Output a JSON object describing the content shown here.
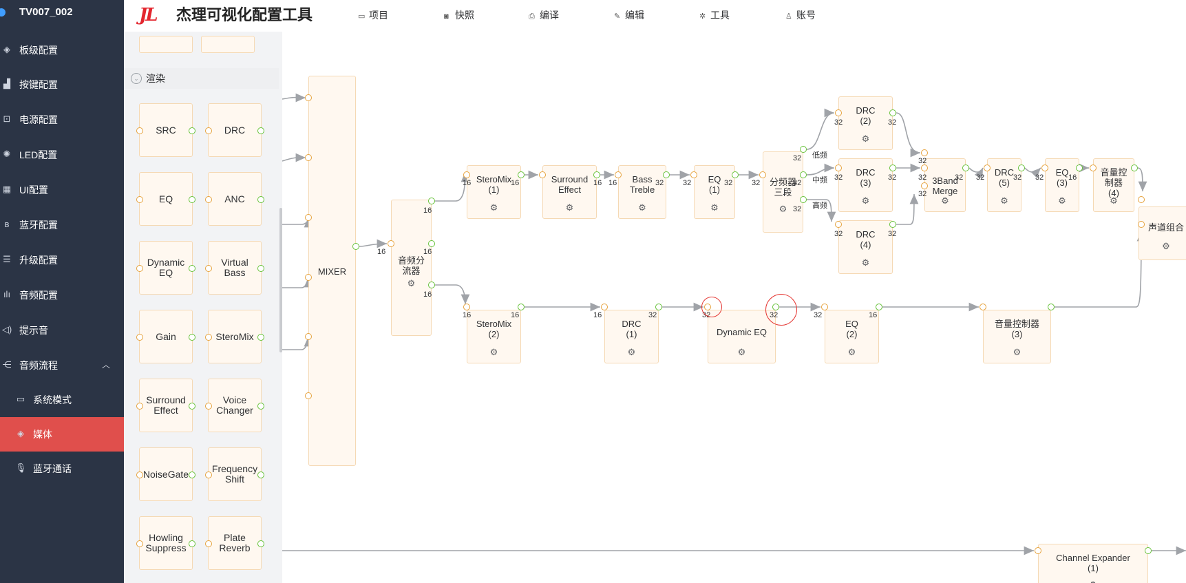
{
  "sidebar": {
    "title": "TV007_002",
    "items": [
      {
        "label": "板级配置",
        "icon": "cube-icon"
      },
      {
        "label": "按键配置",
        "icon": "keys-icon"
      },
      {
        "label": "电源配置",
        "icon": "power-icon"
      },
      {
        "label": "LED配置",
        "icon": "led-icon"
      },
      {
        "label": "UI配置",
        "icon": "ui-grid-icon"
      },
      {
        "label": "蓝牙配置",
        "icon": "bluetooth-icon"
      },
      {
        "label": "升级配置",
        "icon": "list-icon"
      },
      {
        "label": "音频配置",
        "icon": "audio-wave-icon"
      },
      {
        "label": "提示音",
        "icon": "speaker-icon"
      },
      {
        "label": "音频流程",
        "icon": "flow-icon"
      }
    ],
    "sub_items": [
      {
        "label": "系统模式",
        "icon": "monitor-icon"
      },
      {
        "label": "媒体",
        "icon": "cube-icon"
      },
      {
        "label": "蓝牙通话",
        "icon": "microphone-icon"
      }
    ]
  },
  "header": {
    "logo_text": "JL",
    "title": "杰理可视化配置工具",
    "nav": [
      {
        "label": "项目",
        "icon": "folder-icon"
      },
      {
        "label": "快照",
        "icon": "camera-icon"
      },
      {
        "label": "编译",
        "icon": "printer-icon"
      },
      {
        "label": "编辑",
        "icon": "pen-icon"
      },
      {
        "label": "工具",
        "icon": "tools-icon"
      },
      {
        "label": "账号",
        "icon": "user-icon"
      }
    ]
  },
  "palette": {
    "group_label": "渲染",
    "cards": [
      "SRC",
      "DRC",
      "EQ",
      "ANC",
      "Dynamic EQ",
      "Virtual Bass",
      "Gain",
      "SteroMix",
      "Surround Effect",
      "Voice Changer",
      "NoiseGate",
      "Frequency Shift",
      "Howling Suppress",
      "Plate Reverb"
    ]
  },
  "flow": {
    "nodes": [
      {
        "id": "mixer",
        "label": "MIXER"
      },
      {
        "id": "splitter",
        "label": "音频分流器"
      },
      {
        "id": "steromix1",
        "label": "SteroMix (1)"
      },
      {
        "id": "surround",
        "label": "Surround Effect"
      },
      {
        "id": "basstreble",
        "label": "Bass Treble"
      },
      {
        "id": "eq1",
        "label": "EQ (1)"
      },
      {
        "id": "crossover",
        "label": "分频器三段"
      },
      {
        "id": "drc2",
        "label": "DRC (2)"
      },
      {
        "id": "drc3",
        "label": "DRC (3)"
      },
      {
        "id": "drc4",
        "label": "DRC (4)"
      },
      {
        "id": "merge",
        "label": "3Band Merge"
      },
      {
        "id": "drc5",
        "label": "DRC (5)"
      },
      {
        "id": "eq3",
        "label": "EQ (3)"
      },
      {
        "id": "vol4",
        "label": "音量控制器 (4)"
      },
      {
        "id": "chcombine",
        "label": "声道组合"
      },
      {
        "id": "steromix2",
        "label": "SteroMix (2)"
      },
      {
        "id": "drc1",
        "label": "DRC (1)"
      },
      {
        "id": "dyneq",
        "label": "Dynamic EQ"
      },
      {
        "id": "eq2",
        "label": "EQ (2)"
      },
      {
        "id": "vol3",
        "label": "音量控制器 (3)"
      },
      {
        "id": "chexp",
        "label": "Channel Expander (1)"
      }
    ],
    "band_labels": [
      "低频",
      "中频",
      "高频"
    ],
    "bit_depths": [
      "16",
      "32"
    ]
  },
  "colors": {
    "sidebar_bg": "#2b3445",
    "active_item": "#e04f4c",
    "port_in": "#e6a23c",
    "port_out": "#67c23a",
    "node_fill": "#fff8f0",
    "node_border": "#f5d9b4",
    "highlight": "#e53935"
  }
}
